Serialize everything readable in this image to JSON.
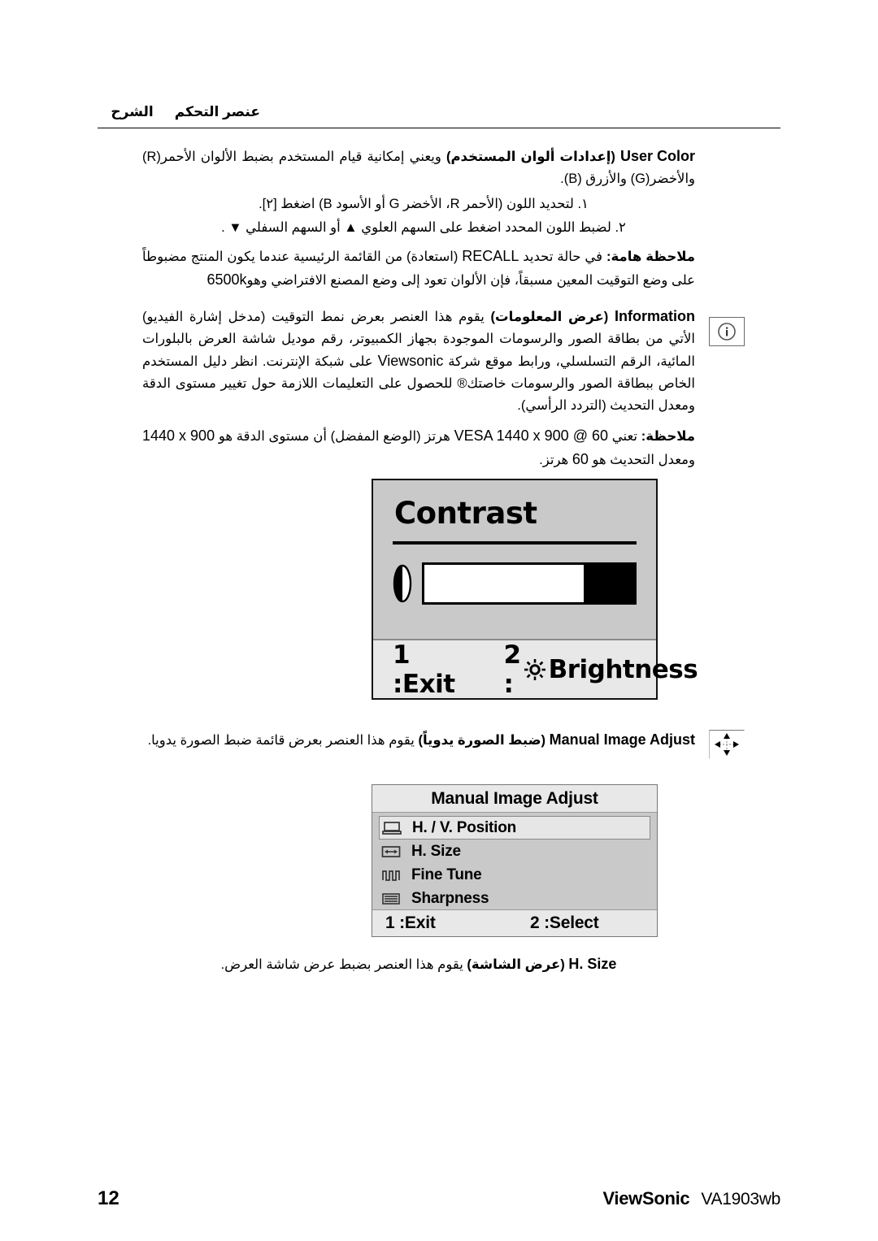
{
  "header": {
    "col_control": "عنصر التحكم",
    "col_description": "الشرح"
  },
  "sections": {
    "user_color": {
      "en_label": "User Color",
      "ar_bold": "(إعدادات ألوان المستخدم)",
      "ar_text": "ويعني إمكانية قيام المستخدم بضبط الألوان الأحمر(R) والأخضر(G) والأزرق (B).",
      "steps": [
        "١. لتحديد اللون (الأحمر R، الأخضر G أو الأسود B) اضغط [٢].",
        "٢. لضبط اللون المحدد اضغط على السهم العلوي ▲ أو السهم السفلي ▼ ."
      ],
      "note_label": "ملاحظة هامة:",
      "note_text_a": "في حالة تحديد",
      "note_en": "RECALL",
      "note_text_b": "(استعادة) من القائمة الرئيسية عندما يكون المنتج مضبوطاً على وضع التوقيت المعين مسبقاً، فإن الألوان تعود إلى وضع المصنع الافتراضي وهو",
      "note_value": "6500k"
    },
    "information": {
      "en_label": "Information",
      "ar_bold": "(عرض المعلومات)",
      "ar_text": "يقوم هذا العنصر بعرض نمط التوقيت (مدخل إشارة الفيديو) الأتي من بطاقة الصور والرسومات الموجودة بجهاز الكمبيوتر، رقم موديل شاشة العرض بالبلورات المائية، الرقم التسلسلي، ورابط موقع شركة",
      "ar_text_b": "على شبكة الإنترنت. انظر دليل المستخدم الخاص ببطاقة الصور والرسومات خاصتك® للحصول على التعليمات اللازمة حول تغيير مستوى الدقة ومعدل التحديث (التردد الرأسي).",
      "brand_inline": "Viewsonic",
      "margin_icon": "info-icon"
    },
    "vesa_note": {
      "note_label": "ملاحظة:",
      "note_text_a": "تعني",
      "note_en": "VESA 1440 x 900 @ 60",
      "note_text_b": "هرتز (الوضع المفضل) أن مستوى الدقة هو",
      "note_res": "1440 x 900",
      "note_text_c": "ومعدل التحديث هو",
      "note_hz": "60",
      "note_text_d": "هرتز."
    },
    "manual_image_adjust": {
      "en_label": "Manual Image Adjust",
      "ar_bold": "(ضبط الصورة يدوياً)",
      "ar_text": "يقوم هذا العنصر بعرض قائمة ضبط الصورة يدويا.",
      "margin_icon": "move-arrows-icon"
    },
    "h_size": {
      "en_label": "H. Size",
      "ar_bold": "(عرض الشاشة)",
      "ar_text": "يقوم هذا العنصر بضبط عرض شاشة العرض."
    }
  },
  "osd_contrast": {
    "title": "Contrast",
    "icon": "contrast-icon",
    "bar_fill_percent": 76,
    "footer": {
      "exit": "1 :Exit",
      "brightness_key": "2 :",
      "brightness_label": "Brightness",
      "brightness_icon": "sun-icon"
    },
    "colors": {
      "background": "#c9c9c9",
      "footer_background": "#e8e8e8",
      "bar_fill": "#ffffff",
      "bar_empty": "#000000"
    }
  },
  "osd_manual_image_adjust": {
    "title": "Manual Image Adjust",
    "items": [
      {
        "label": "H. / V. Position",
        "icon": "monitor-icon",
        "selected": true
      },
      {
        "label": "H. Size",
        "icon": "horizontal-arrows-icon",
        "selected": false
      },
      {
        "label": "Fine Tune",
        "icon": "waveform-icon",
        "selected": false
      },
      {
        "label": "Sharpness",
        "icon": "lines-icon",
        "selected": false
      }
    ],
    "footer": {
      "exit": "1 :Exit",
      "select": "2 :Select"
    },
    "colors": {
      "background": "#c9c9c9",
      "title_background": "#e8e8e8",
      "selected_background": "#e6e6e6"
    }
  },
  "footer": {
    "page_number": "12",
    "brand": "ViewSonic",
    "model": "VA1903wb"
  }
}
